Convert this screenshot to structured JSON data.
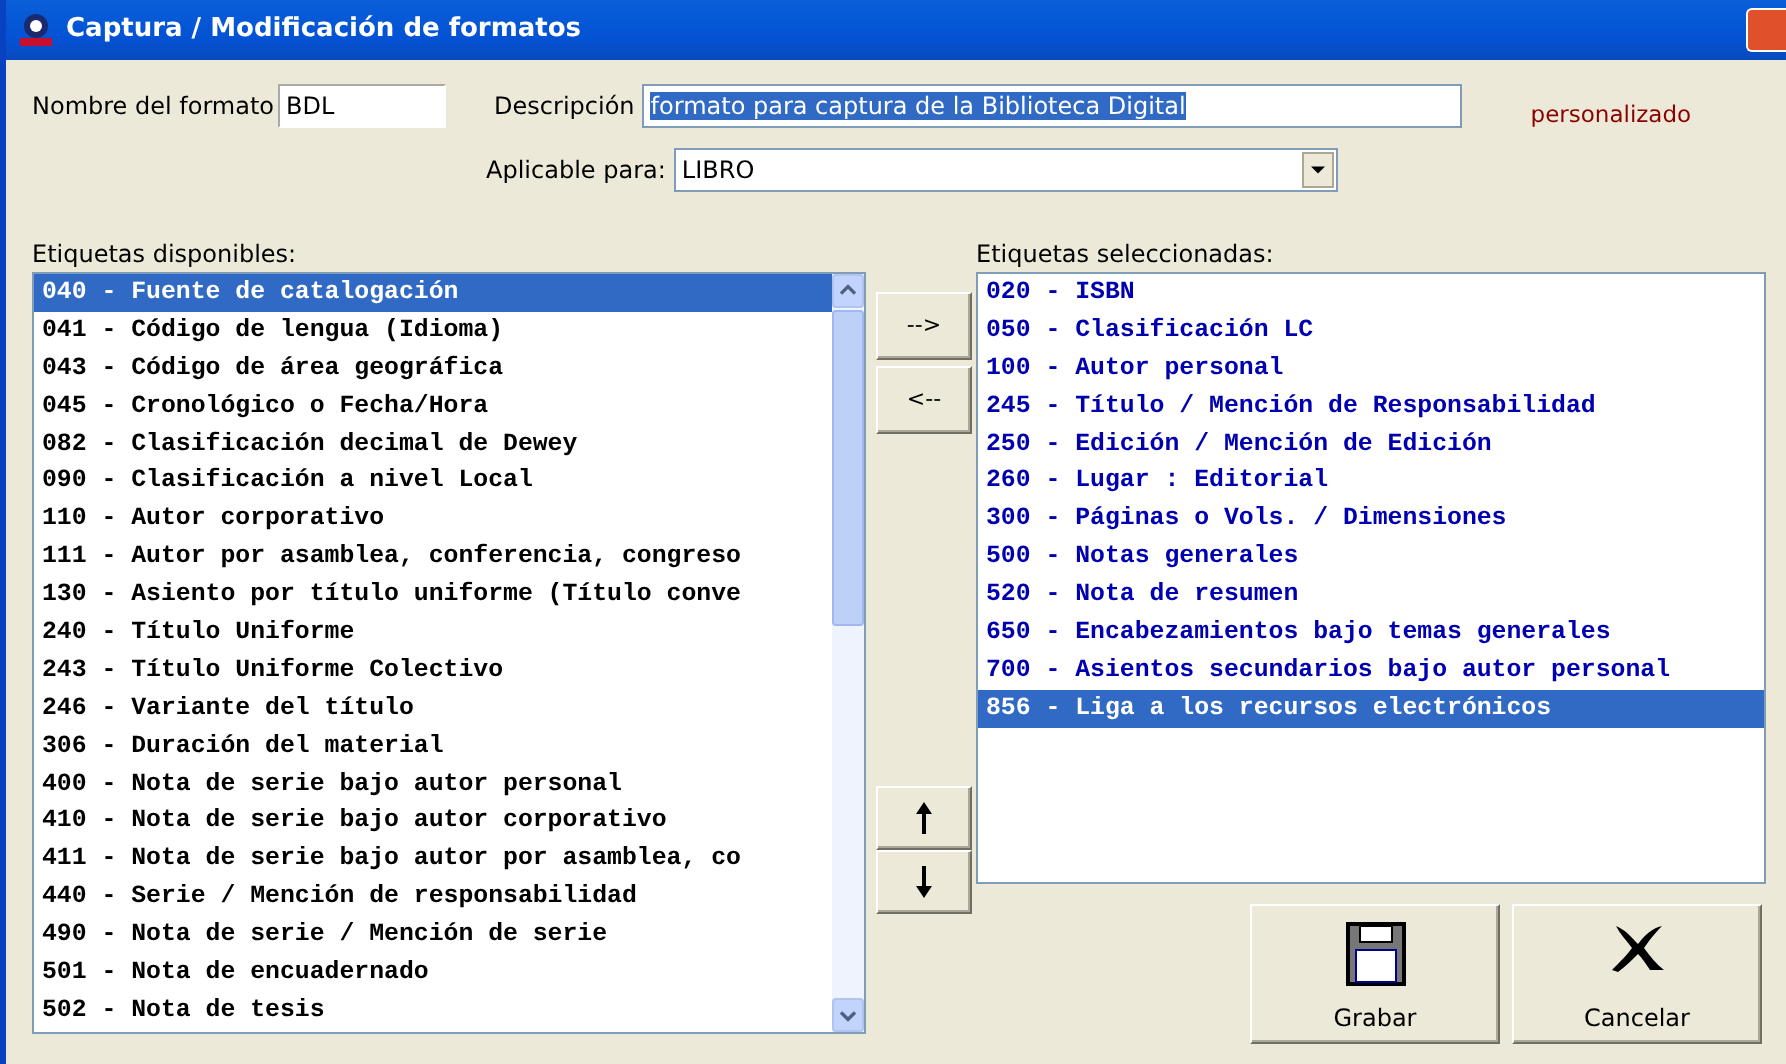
{
  "window": {
    "title": "Captura / Modificación de formatos"
  },
  "format_name": {
    "label": "Nombre del formato",
    "value": "BDL"
  },
  "description": {
    "label": "Descripción",
    "value": "formato para captura de la Biblioteca Digital",
    "text_selected": true
  },
  "status_note": "personalizado",
  "applicable": {
    "label": "Aplicable para:",
    "value": "LIBRO"
  },
  "available": {
    "label": "Etiquetas disponibles:",
    "items": [
      {
        "text": "040 - Fuente de catalogación",
        "selected": true
      },
      {
        "text": "041 - Código de lengua (Idioma)",
        "selected": false
      },
      {
        "text": "043 - Código de área geográfica",
        "selected": false
      },
      {
        "text": "045 - Cronológico o Fecha/Hora",
        "selected": false
      },
      {
        "text": "082 - Clasificación decimal de Dewey",
        "selected": false
      },
      {
        "text": "090 - Clasificación a nivel Local",
        "selected": false
      },
      {
        "text": "110 - Autor corporativo",
        "selected": false
      },
      {
        "text": "111 - Autor por asamblea, conferencia, congreso",
        "selected": false
      },
      {
        "text": "130 - Asiento por título uniforme (Título conve",
        "selected": false
      },
      {
        "text": "240 - Título Uniforme",
        "selected": false
      },
      {
        "text": "243 - Título Uniforme Colectivo",
        "selected": false
      },
      {
        "text": "246 - Variante del título",
        "selected": false
      },
      {
        "text": "306 - Duración del material",
        "selected": false
      },
      {
        "text": "400 - Nota de serie bajo autor personal",
        "selected": false
      },
      {
        "text": "410 - Nota de serie bajo autor corporativo",
        "selected": false
      },
      {
        "text": "411 - Nota de serie bajo autor por asamblea, co",
        "selected": false
      },
      {
        "text": "440 - Serie / Mención de responsabilidad",
        "selected": false
      },
      {
        "text": "490 - Nota de serie / Mención de serie",
        "selected": false
      },
      {
        "text": "501 - Nota de encuadernado",
        "selected": false
      },
      {
        "text": "502 - Nota de tesis",
        "selected": false
      }
    ]
  },
  "move_buttons": [
    "-->",
    "<--"
  ],
  "selected_tags": {
    "label": "Etiquetas seleccionadas:",
    "items": [
      {
        "text": "020 - ISBN",
        "selected": false
      },
      {
        "text": "050 - Clasificación LC",
        "selected": false
      },
      {
        "text": "100 - Autor personal",
        "selected": false
      },
      {
        "text": "245 - Título / Mención de Responsabilidad",
        "selected": false
      },
      {
        "text": "250 - Edición / Mención de Edición",
        "selected": false
      },
      {
        "text": "260 - Lugar : Editorial",
        "selected": false
      },
      {
        "text": "300 - Páginas o Vols. / Dimensiones",
        "selected": false
      },
      {
        "text": "500 - Notas generales",
        "selected": false
      },
      {
        "text": "520 - Nota de resumen",
        "selected": false
      },
      {
        "text": "650 - Encabezamientos bajo temas generales",
        "selected": false
      },
      {
        "text": "700 - Asientos secundarios bajo autor personal",
        "selected": false
      },
      {
        "text": "856 - Liga a los recursos electrónicos",
        "selected": true
      }
    ]
  },
  "actions": [
    {
      "kind": "save",
      "label": "Grabar"
    },
    {
      "kind": "cancel",
      "label": "Cancelar"
    }
  ]
}
